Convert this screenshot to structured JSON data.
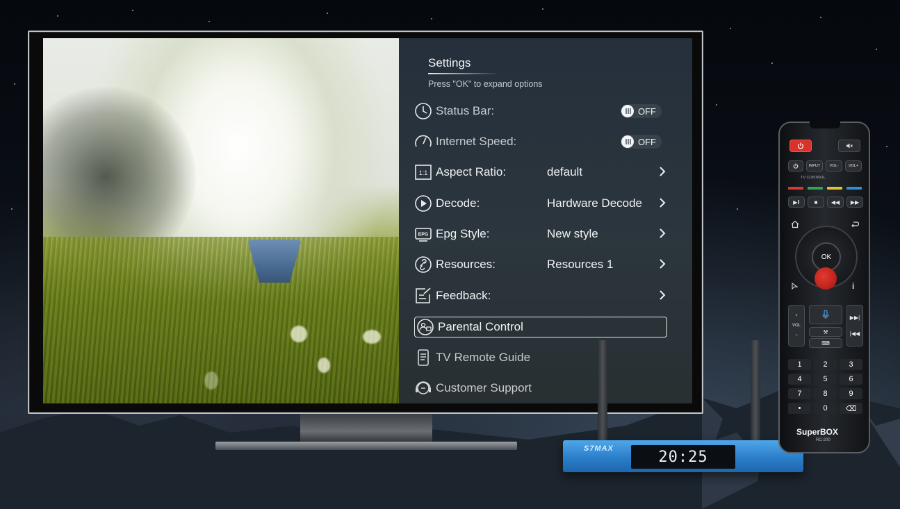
{
  "settings": {
    "title": "Settings",
    "hint": "Press \"OK\" to expand options",
    "items": [
      {
        "label": "Status Bar:",
        "toggle": "OFF"
      },
      {
        "label": "Internet Speed:",
        "toggle": "OFF"
      },
      {
        "label": "Aspect Ratio:",
        "value": "default"
      },
      {
        "label": "Decode:",
        "value": "Hardware Decode"
      },
      {
        "label": "Epg Style:",
        "value": "New style"
      },
      {
        "label": "Resources:",
        "value": "Resources 1"
      },
      {
        "label": "Feedback:"
      },
      {
        "label": "Parental Control",
        "focused": true
      },
      {
        "label": "TV Remote Guide"
      },
      {
        "label": "Customer Support"
      }
    ],
    "epg_icon_text": "EPG",
    "aspect_icon_text": "1:1"
  },
  "tv_box": {
    "brand": "S7MAX",
    "clock": "20:25"
  },
  "remote": {
    "brand": "SuperBOX",
    "model": "RC-200",
    "tv_control_label": "TV CONTROL",
    "input_label": "INPUT",
    "vol_minus_label": "VOL-",
    "vol_plus_label": "VOL+",
    "ok_label": "OK",
    "vol_label": "VOL",
    "info_label": "i",
    "keys": [
      "1",
      "2",
      "3",
      "4",
      "5",
      "6",
      "7",
      "8",
      "9",
      "•",
      "0",
      "⌫"
    ]
  },
  "colors": {
    "panel_text": "#f1f3f5",
    "focus_border": "#e6eaee",
    "remote_red": "#d9322c",
    "box_blue": "#2b7fca"
  }
}
